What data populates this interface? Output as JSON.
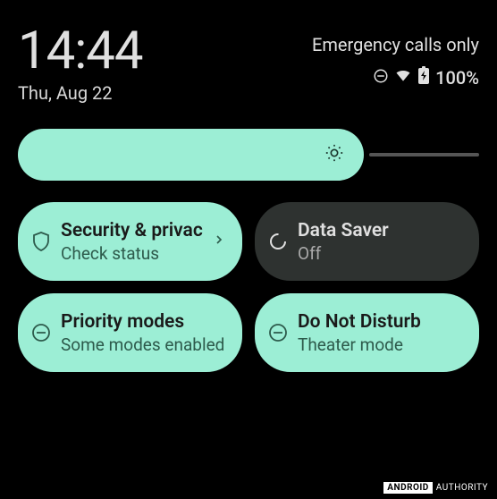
{
  "status": {
    "time": "14:44",
    "date": "Thu, Aug 22",
    "network_text": "Emergency calls only",
    "battery_percent": "100%"
  },
  "brightness": {
    "level_percent": 75
  },
  "tiles": [
    {
      "id": "security",
      "title": "Security & privacy",
      "subtitle": "Check status",
      "state": "on",
      "icon": "shield-icon",
      "has_chevron": true
    },
    {
      "id": "data-saver",
      "title": "Data Saver",
      "subtitle": "Off",
      "state": "off",
      "icon": "data-saver-icon",
      "has_chevron": false
    },
    {
      "id": "priority-modes",
      "title": "Priority modes",
      "subtitle": "Some modes enabled",
      "state": "on",
      "icon": "dnd-icon",
      "has_chevron": false
    },
    {
      "id": "do-not-disturb",
      "title": "Do Not Disturb",
      "subtitle": "Theater mode",
      "state": "on",
      "icon": "dnd-icon",
      "has_chevron": false
    }
  ],
  "watermark": {
    "brand_box": "ANDROID",
    "brand_text": "AUTHORITY"
  },
  "colors": {
    "accent": "#9ceed5",
    "tile_off_bg": "#2e3230",
    "bg": "#000000"
  }
}
